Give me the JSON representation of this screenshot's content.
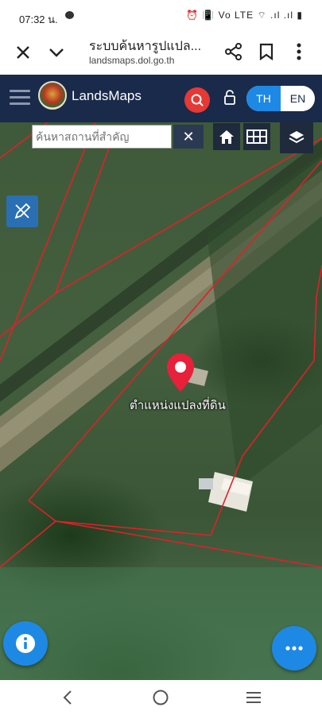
{
  "status_bar": {
    "time": "07:32 น.",
    "indicators": "⏰ 📳 Vo LTE ⌔ .ıl .ıl ▮"
  },
  "browser": {
    "title": "ระบบค้นหารูปแปล...",
    "url": "landsmaps.dol.go.th",
    "icons": [
      "close-icon",
      "chevron-down-icon",
      "share-icon",
      "bookmark-icon",
      "more-vert-icon"
    ]
  },
  "header": {
    "brand": "LandsMaps",
    "lang_options": [
      "TH",
      "EN"
    ],
    "active_lang": "TH",
    "colors": {
      "bar": "#1a2a4a",
      "search_button": "#e53935",
      "accent": "#1e88e5"
    }
  },
  "map": {
    "search": {
      "placeholder": "ค้นหาสถานที่สำคัญ",
      "value": ""
    },
    "clear_label": "✕",
    "marker_label": "ตำแหน่งแปลงที่ดิน",
    "tools": [
      "home-icon",
      "grid-icon",
      "layers-icon",
      "edit-tool-icon"
    ]
  },
  "nav": {
    "icons": [
      "back-icon",
      "home-circle-icon",
      "recents-icon"
    ]
  }
}
